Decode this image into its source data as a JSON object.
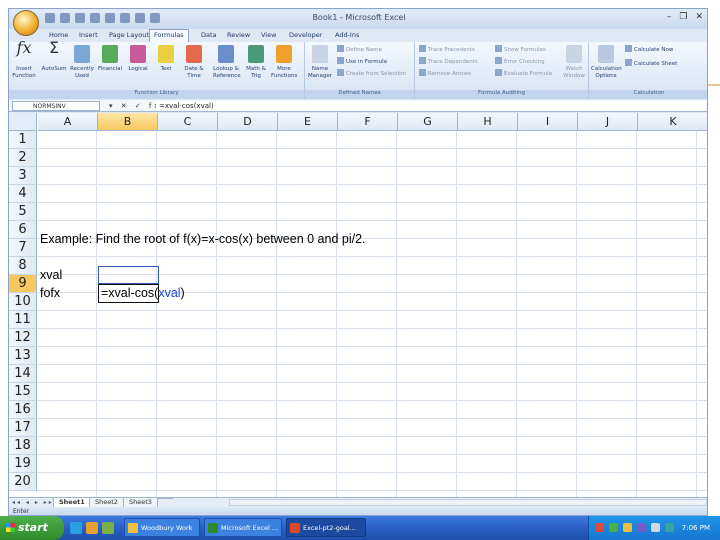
{
  "window": {
    "title": "Book1 - Microsoft Excel",
    "controls": [
      "–",
      "❐",
      "✕"
    ]
  },
  "ribbon_tabs": [
    "Home",
    "Insert",
    "Page Layout",
    "Formulas",
    "Data",
    "Review",
    "View",
    "Developer",
    "Add-Ins"
  ],
  "active_tab": "Formulas",
  "ribbon": {
    "function_library": {
      "label": "Function Library",
      "buttons": [
        "Insert Function",
        "AutoSum",
        "Recently Used",
        "Financial",
        "Logical",
        "Text",
        "Date & Time",
        "Lookup & Reference",
        "Math & Trig",
        "More Functions"
      ]
    },
    "defined_names": {
      "label": "Defined Names",
      "name_manager": "Name Manager",
      "define_name": "Define Name",
      "use_in_formula": "Use in Formula",
      "create_from_selection": "Create from Selection"
    },
    "formula_auditing": {
      "label": "Formula Auditing",
      "trace_precedents": "Trace Precedents",
      "trace_dependents": "Trace Dependents",
      "remove_arrows": "Remove Arrows",
      "show_formulas": "Show Formulas",
      "error_checking": "Error Checking",
      "evaluate_formula": "Evaluate Formula",
      "watch_window": "Watch Window"
    },
    "calculation": {
      "label": "Calculation",
      "calc_options": "Calculation Options",
      "calc_now": "Calculate Now",
      "calc_sheet": "Calculate Sheet"
    }
  },
  "formula_bar": {
    "name_box": "NORMSINV",
    "buttons": "▾ ✕ ✓ fx",
    "formula": "=xval-cos(xval)"
  },
  "columns": [
    "A",
    "B",
    "C",
    "D",
    "E",
    "F",
    "G",
    "H",
    "I",
    "J",
    "K"
  ],
  "selected_column": "B",
  "rows": [
    "1",
    "2",
    "3",
    "4",
    "5",
    "6",
    "7",
    "8",
    "9",
    "10",
    "11",
    "12",
    "13",
    "14",
    "15",
    "16",
    "17",
    "18",
    "19",
    "20"
  ],
  "selected_row": "9",
  "cells": {
    "a6": "Example: Find the root of f(x)=x-cos(x) between 0 and pi/2.",
    "a8": "xval",
    "a9": "fofx",
    "b9_prefix": "=xval-cos(",
    "b9_ref": "xval",
    "b9_suffix": ")"
  },
  "sheet_tabs": [
    "Sheet1",
    "Sheet2",
    "Sheet3"
  ],
  "active_sheet": "Sheet1",
  "sheet_nav": "◂◂ ◂ ▸ ▸▸",
  "status": "Enter",
  "taskbar": {
    "start": "start",
    "tasks": [
      "Woodbury Work",
      "Microsoft Excel ...",
      "Excel-pt2-goal..."
    ],
    "clock": "7:06 PM"
  },
  "colors": {
    "ribbon": "#dfe8f5",
    "taskbar": "#2a5fc5",
    "start": "#2e8a2a",
    "selected_header": "#f8c760",
    "reference": "#2244cc"
  }
}
